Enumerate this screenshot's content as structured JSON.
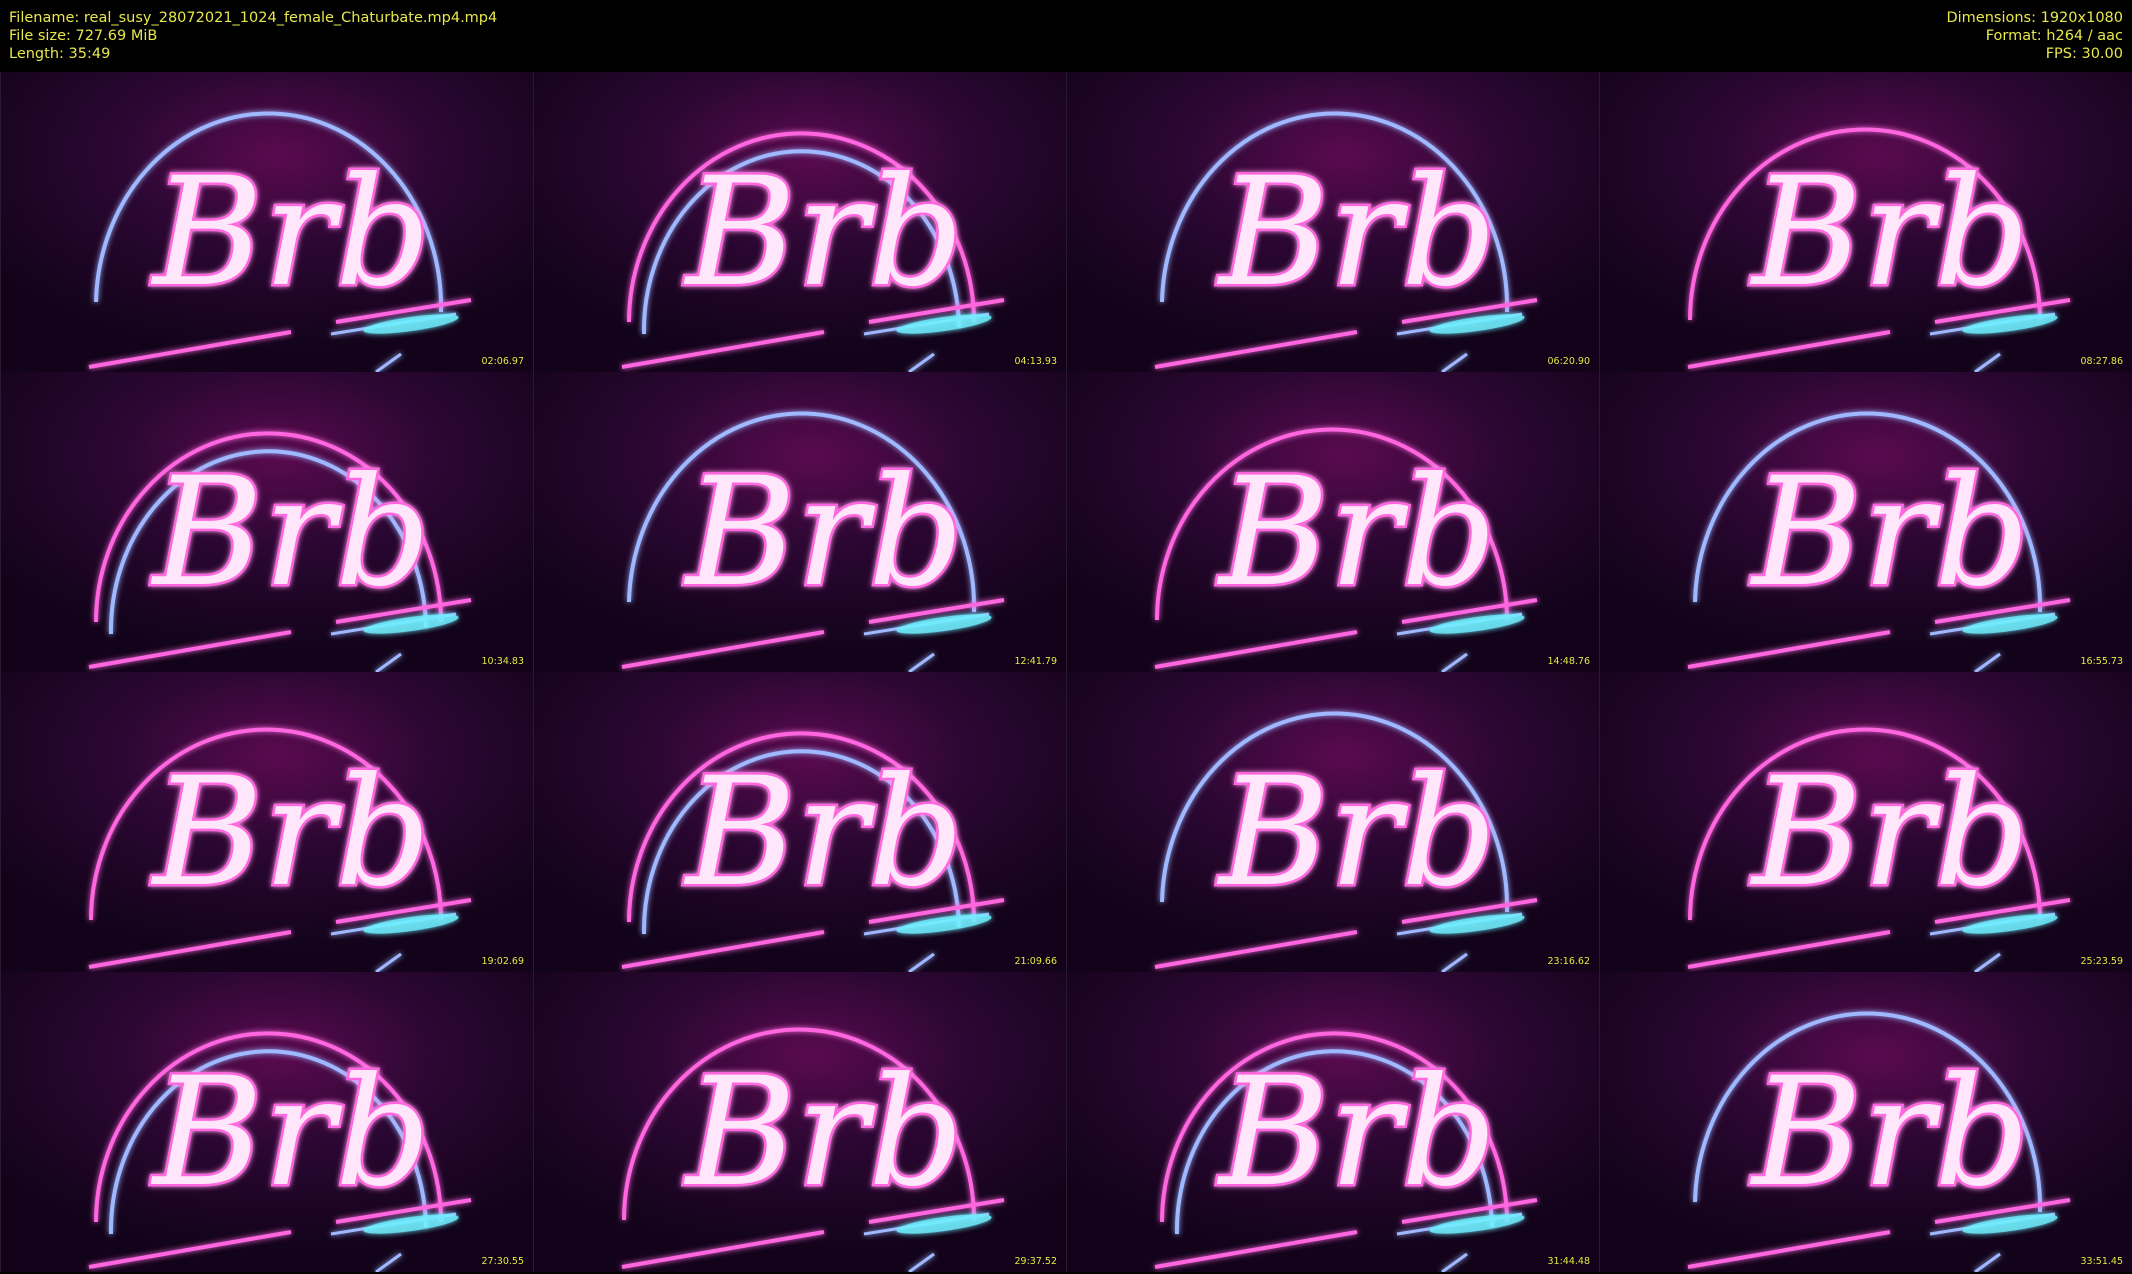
{
  "header": {
    "filename": "Filename: real_susy_28072021_1024_female_Chaturbate.mp4.mp4",
    "filesize": "File size: 727.69 MiB",
    "length": "Length: 35:49",
    "dimensions": "Dimensions: 1920x1080",
    "format": "Format: h264 / aac",
    "fps": "FPS: 30.00"
  },
  "thumb_text": "Brb",
  "colors": {
    "text_yellow": "#e8e84a",
    "neon_pink": "#ff66e0",
    "neon_blue": "#9fb8ff",
    "neon_cyan": "#6ff0ff",
    "bg_purple": "#13031a"
  },
  "thumbnails": [
    {
      "time": "02:06.97",
      "arc": "blue"
    },
    {
      "time": "04:13.93",
      "arc": "both"
    },
    {
      "time": "06:20.90",
      "arc": "blue"
    },
    {
      "time": "08:27.86",
      "arc": "pink"
    },
    {
      "time": "10:34.83",
      "arc": "both"
    },
    {
      "time": "12:41.79",
      "arc": "blue"
    },
    {
      "time": "14:48.76",
      "arc": "pink"
    },
    {
      "time": "16:55.73",
      "arc": "blue"
    },
    {
      "time": "19:02.69",
      "arc": "pink"
    },
    {
      "time": "21:09.66",
      "arc": "both"
    },
    {
      "time": "23:16.62",
      "arc": "blue"
    },
    {
      "time": "25:23.59",
      "arc": "pink"
    },
    {
      "time": "27:30.55",
      "arc": "both"
    },
    {
      "time": "29:37.52",
      "arc": "pink"
    },
    {
      "time": "31:44.48",
      "arc": "both"
    },
    {
      "time": "33:51.45",
      "arc": "blue"
    }
  ]
}
